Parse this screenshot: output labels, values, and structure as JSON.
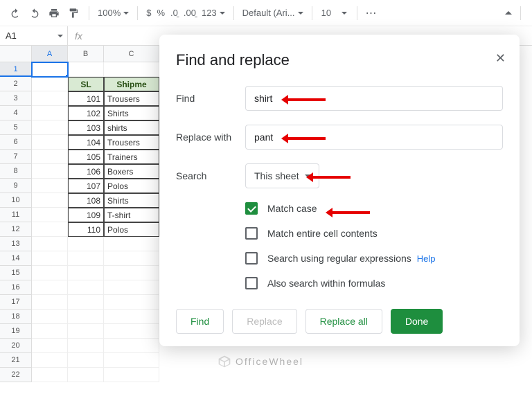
{
  "toolbar": {
    "zoom": "100%",
    "font": "Default (Ari...",
    "font_size": "10",
    "number_format": "123"
  },
  "formula_bar": {
    "cell_ref": "A1"
  },
  "columns": [
    "A",
    "B",
    "C"
  ],
  "row_numbers": [
    "1",
    "2",
    "3",
    "4",
    "5",
    "6",
    "7",
    "8",
    "9",
    "10",
    "11",
    "12",
    "13",
    "14",
    "15",
    "16",
    "17",
    "18",
    "19",
    "20",
    "21",
    "22"
  ],
  "table": {
    "headers": [
      "SL",
      "Shipme"
    ],
    "rows": [
      [
        "101",
        "Trousers"
      ],
      [
        "102",
        "Shirts"
      ],
      [
        "103",
        "shirts"
      ],
      [
        "104",
        "Trousers"
      ],
      [
        "105",
        "Trainers"
      ],
      [
        "106",
        "Boxers"
      ],
      [
        "107",
        "Polos"
      ],
      [
        "108",
        "Shirts"
      ],
      [
        "109",
        "T-shirt"
      ],
      [
        "110",
        "Polos"
      ]
    ]
  },
  "dialog": {
    "title": "Find and replace",
    "find_label": "Find",
    "find_value": "shirt",
    "replace_label": "Replace with",
    "replace_value": "pant",
    "search_label": "Search",
    "search_scope": "This sheet",
    "opt_match_case": "Match case",
    "opt_entire_cell": "Match entire cell contents",
    "opt_regex": "Search using regular expressions",
    "opt_regex_help": "Help",
    "opt_formulas": "Also search within formulas",
    "btn_find": "Find",
    "btn_replace": "Replace",
    "btn_replace_all": "Replace all",
    "btn_done": "Done"
  },
  "watermark": "OfficeWheel"
}
